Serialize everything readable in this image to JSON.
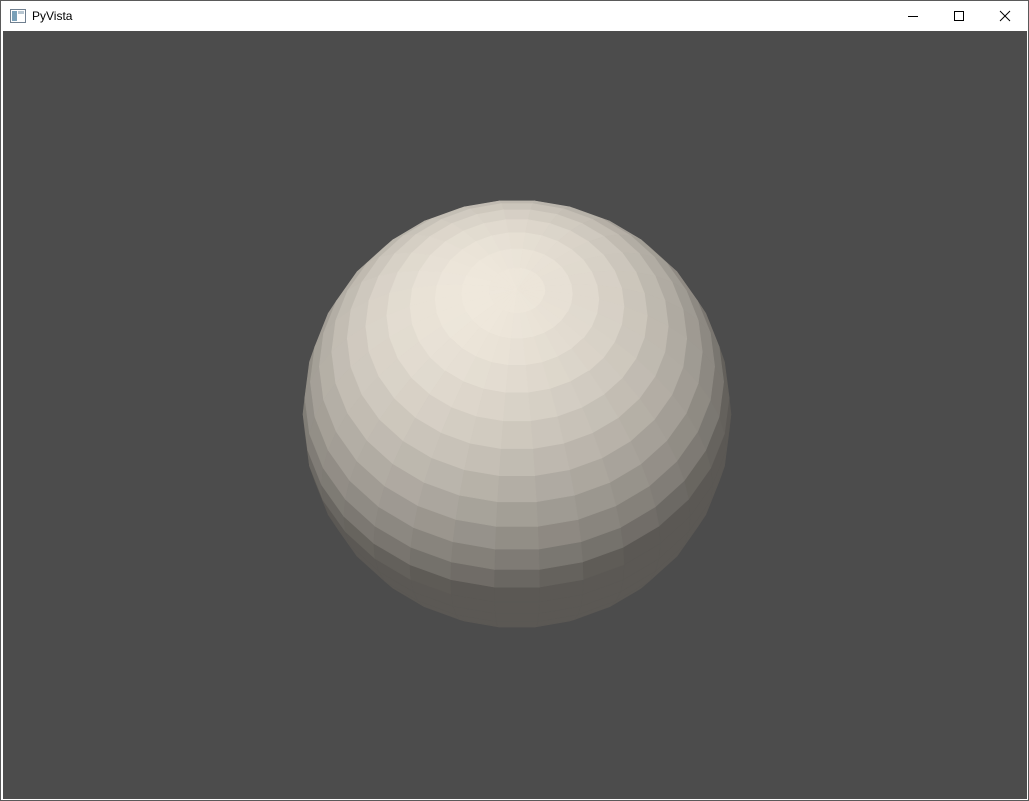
{
  "window": {
    "title": "PyVista",
    "app_icon": "window-app-icon"
  },
  "controls": {
    "minimize_icon": "minimize-icon",
    "maximize_icon": "maximize-icon",
    "close_icon": "close-icon"
  },
  "viewport": {
    "background_color": "#4c4c4c",
    "mesh": {
      "shape": "sphere",
      "color": "#efe8dc"
    }
  }
}
